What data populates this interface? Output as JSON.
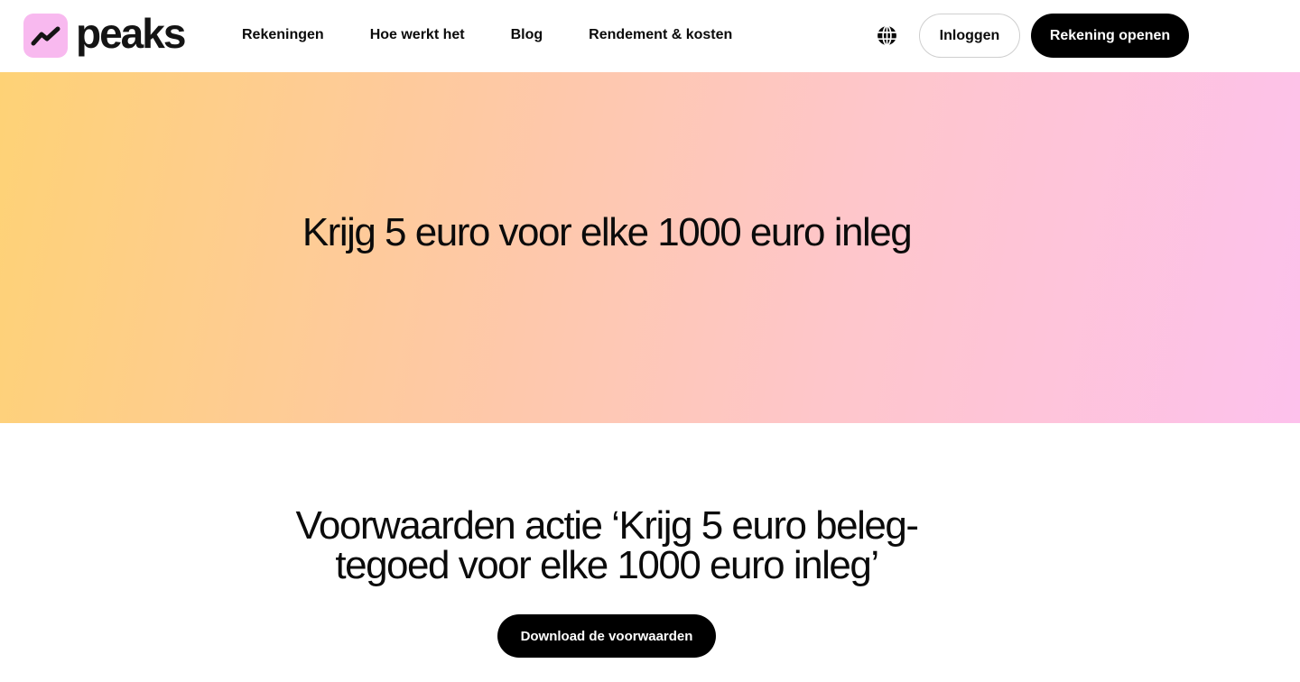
{
  "header": {
    "logo_text": "peaks",
    "logo_icon": "trend-line-icon",
    "nav": [
      {
        "label": "Rekeningen"
      },
      {
        "label": "Hoe werkt het"
      },
      {
        "label": "Blog"
      },
      {
        "label": "Rendement & kosten"
      }
    ],
    "language_icon": "globe-icon",
    "login_label": "Inloggen",
    "open_account_label": "Rekening openen"
  },
  "hero": {
    "title": "Krijg 5 euro voor elke 1000 euro inleg"
  },
  "terms": {
    "title": "Voorwaarden actie ‘Krijg 5 euro beleg-tegoed voor elke 1000 euro inleg’",
    "download_label": "Download de voorwaarden"
  },
  "colors": {
    "logo_background": "#f8b9ef",
    "hero_gradient_start": "#fed276",
    "hero_gradient_end": "#fdc1ec",
    "primary_button": "#000000"
  }
}
